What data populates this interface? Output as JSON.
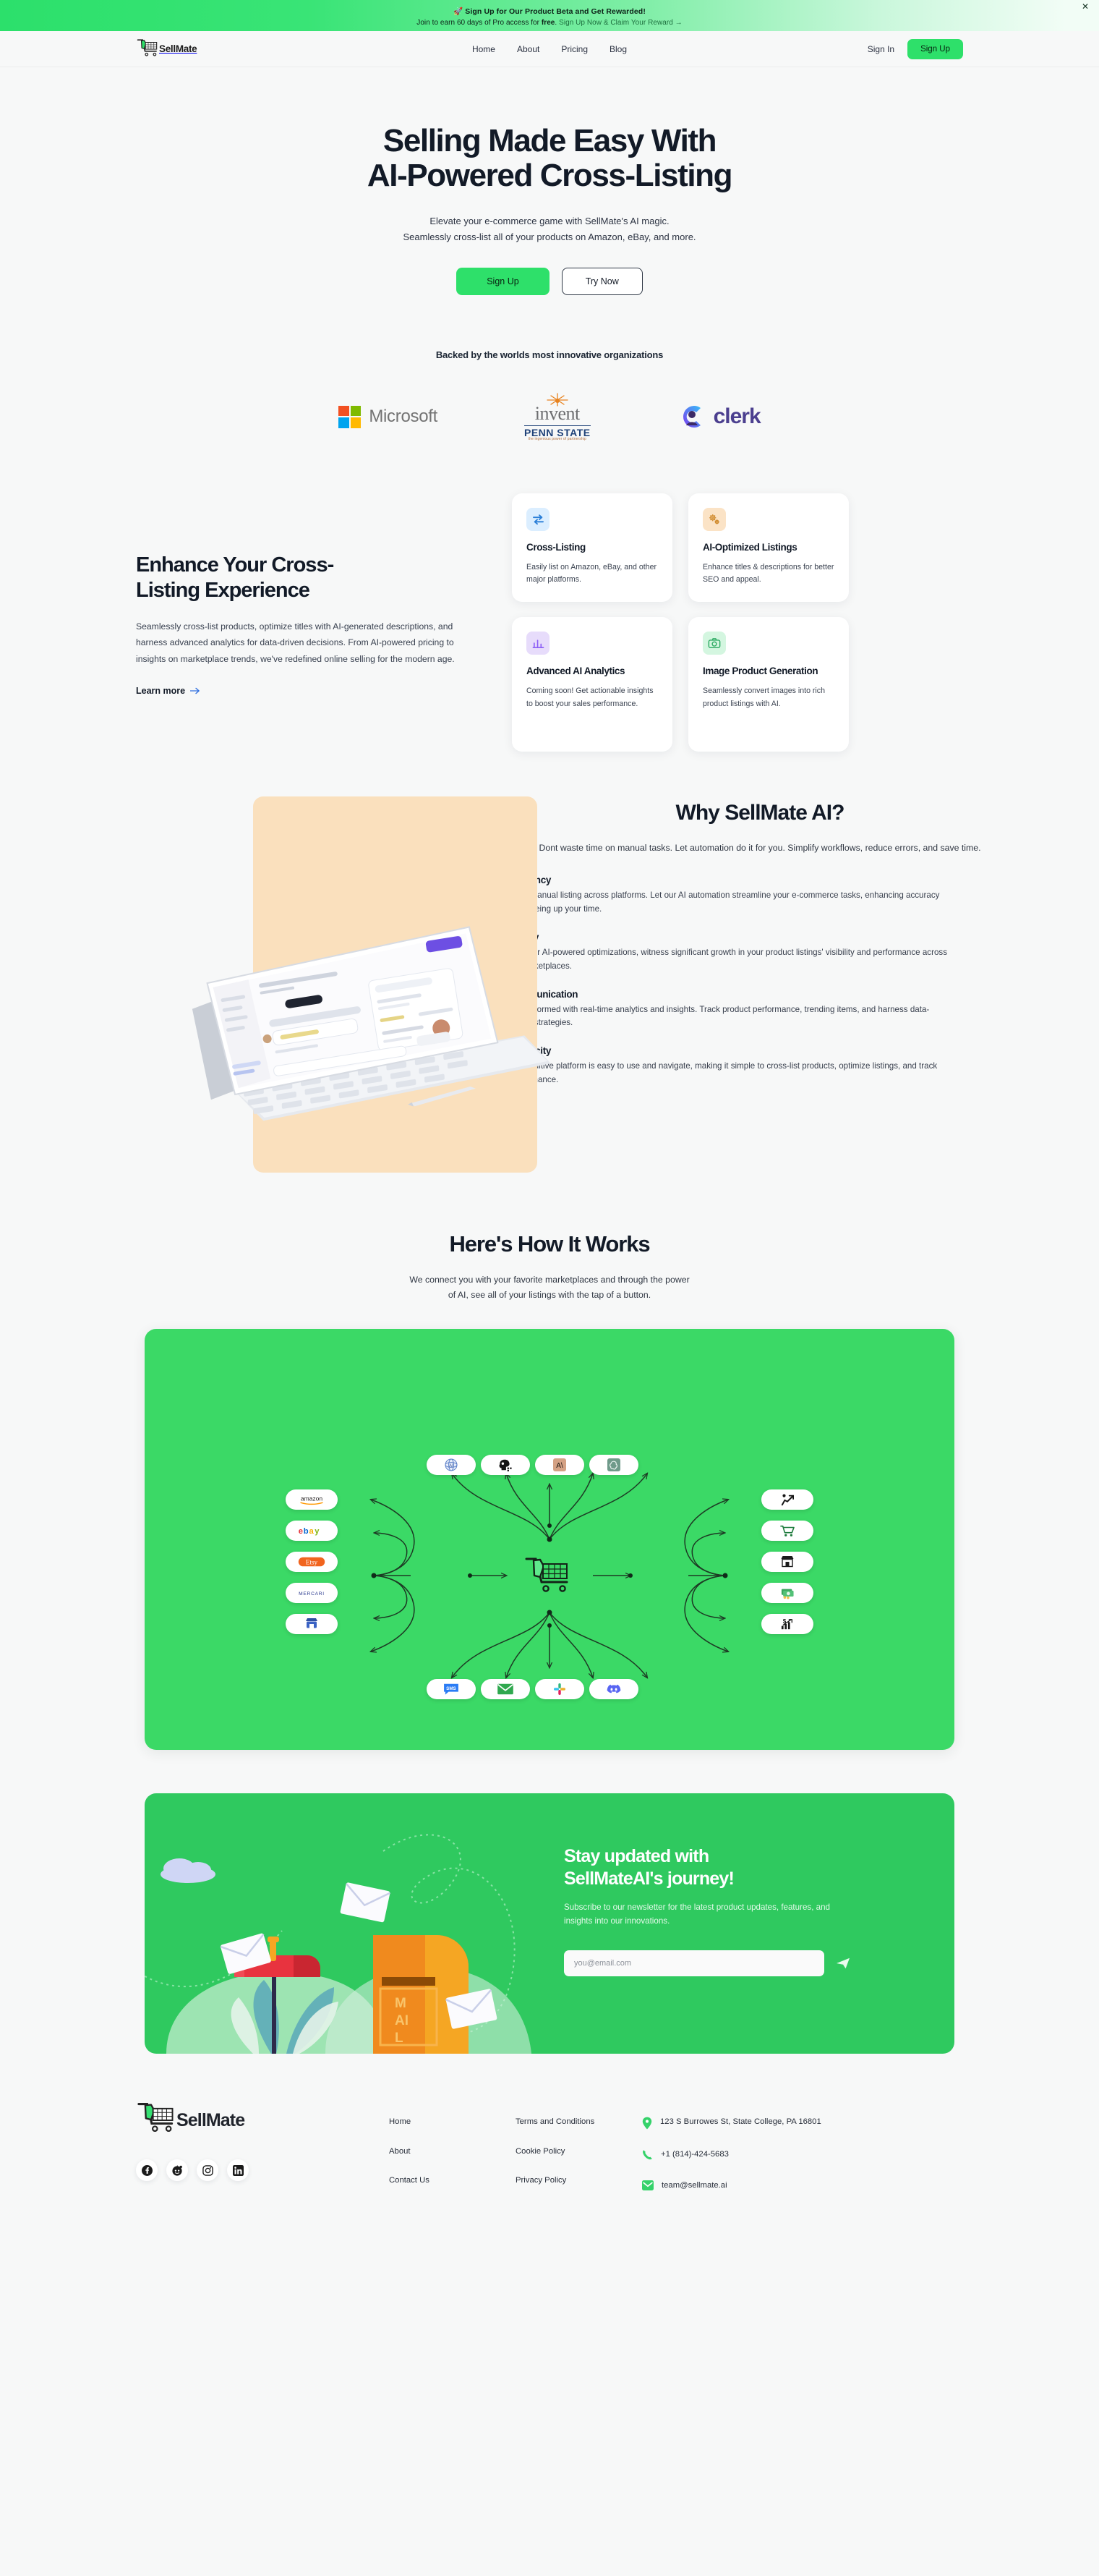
{
  "announcement": {
    "rocket_icon": "rocket-icon",
    "line1": "Sign Up for Our Product Beta and Get Rewarded!",
    "line2_prefix": "Join to earn 60 days of Pro access for ",
    "line2_bold": "free",
    "line2_mid": ". ",
    "line2_link": "Sign Up Now & Claim Your Reward →",
    "close_label": "✕"
  },
  "header": {
    "brand": "SellMate",
    "nav": [
      {
        "label": "Home"
      },
      {
        "label": "About"
      },
      {
        "label": "Pricing"
      },
      {
        "label": "Blog"
      }
    ],
    "sign_in": "Sign In",
    "sign_up": "Sign Up"
  },
  "hero": {
    "title_line1": "Selling Made Easy With",
    "title_line2": "AI-Powered Cross-Listing",
    "sub_line1": "Elevate your e-commerce game with SellMate's AI magic.",
    "sub_line2": "Seamlessly cross-list all of your products on Amazon, eBay, and more.",
    "cta_primary": "Sign Up",
    "cta_secondary": "Try Now"
  },
  "backers": {
    "heading": "Backed by the worlds most innovative organizations",
    "logos": [
      {
        "name": "Microsoft",
        "word": "Microsoft"
      },
      {
        "name": "Invent Penn State",
        "invent": "invent",
        "state": "PENN STATE",
        "tagline": "the ingenious power of partnership"
      },
      {
        "name": "Clerk",
        "word": "clerk"
      }
    ]
  },
  "enhance": {
    "title_line1": "Enhance Your Cross-",
    "title_line2": "Listing Experience",
    "body": "Seamlessly cross-list products, optimize titles with AI-generated descriptions, and harness advanced analytics for data-driven decisions. From AI-powered pricing to insights on marketplace trends, we've redefined online selling for the modern age.",
    "learn_more": "Learn more",
    "cards": [
      {
        "icon": "swap-arrows-icon",
        "icon_bg": "#dbeeff",
        "icon_color": "#2b7fd8",
        "title": "Cross-Listing",
        "body": "Easily list on Amazon, eBay, and other major platforms."
      },
      {
        "icon": "gears-icon",
        "icon_bg": "#fbe3c6",
        "icon_color": "#d08a2c",
        "title": "AI-Optimized Listings",
        "body": "Enhance titles & descriptions for better SEO and appeal."
      },
      {
        "icon": "bar-chart-icon",
        "icon_bg": "#e7dcfb",
        "icon_color": "#8b5cf6",
        "title": "Advanced AI Analytics",
        "body": "Coming soon! Get actionable insights to boost your sales performance."
      },
      {
        "icon": "camera-icon",
        "icon_bg": "#d4f6e0",
        "icon_color": "#2eab63",
        "title": "Image Product Generation",
        "body": "Seamlessly convert images into rich product listings with AI."
      }
    ]
  },
  "why": {
    "title": "Why SellMate AI?",
    "subtitle": "Dont waste time on manual tasks. Let automation do it for you. Simplify workflows, reduce errors, and save time.",
    "items": [
      {
        "title": "Efficiency",
        "body": "Ditch manual listing across platforms. Let our AI automation streamline your e-commerce tasks, enhancing accuracy and freeing up your time."
      },
      {
        "title": "Quality",
        "body": "With our AI-powered optimizations, witness significant growth in your product listings' visibility and performance across all marketplaces."
      },
      {
        "title": "Communication",
        "body": "Stay informed with real-time analytics and insights. Track product performance, trending items, and harness data-driven strategies."
      },
      {
        "title": "Simplicity",
        "body": "Our intuitive platform is easy to use and navigate, making it simple to cross-list products, optimize listings, and track performance."
      }
    ]
  },
  "how": {
    "title": "Here's How It Works",
    "subtitle_line1": "We connect you with your favorite marketplaces and through the power",
    "subtitle_line2": "of AI, see all of your listings with the tap of a button.",
    "panel_color": "#3bd966",
    "diagram": {
      "center": "sellmate-cart-logo",
      "top_row": [
        {
          "name": "ai21-icon",
          "label": "AI21"
        },
        {
          "name": "ai-brain-icon",
          "label": "AI Brain"
        },
        {
          "name": "anthropic-icon",
          "label": "Anthropic"
        },
        {
          "name": "openai-icon",
          "label": "OpenAI"
        }
      ],
      "left_column": [
        {
          "name": "amazon-logo",
          "label": "amazon"
        },
        {
          "name": "ebay-logo",
          "label": "ebay"
        },
        {
          "name": "etsy-logo",
          "label": "Etsy"
        },
        {
          "name": "mercari-logo",
          "label": "MERCARI"
        },
        {
          "name": "storefront-icon",
          "label": "Shopify"
        }
      ],
      "right_column": [
        {
          "name": "growth-icon",
          "label": "Growth"
        },
        {
          "name": "cart-icon",
          "label": "Cart"
        },
        {
          "name": "store-icon",
          "label": "Store"
        },
        {
          "name": "money-icon",
          "label": "Money"
        },
        {
          "name": "revenue-chart-icon",
          "label": "Revenue"
        }
      ],
      "bottom_row": [
        {
          "name": "sms-icon",
          "label": "SMS"
        },
        {
          "name": "email-icon",
          "label": "Email"
        },
        {
          "name": "slack-icon",
          "label": "Slack"
        },
        {
          "name": "discord-icon",
          "label": "Discord"
        }
      ]
    }
  },
  "newsletter": {
    "title_line1": "Stay updated with",
    "title_line2": "SellMateAI's journey!",
    "body": "Subscribe to our newsletter for the latest product updates, features, and insights into our innovations.",
    "input_placeholder": "you@email.com",
    "input_value": "",
    "send_icon": "send-icon"
  },
  "footer": {
    "brand": "SellMate",
    "socials": [
      {
        "name": "facebook-icon",
        "label": "Facebook"
      },
      {
        "name": "reddit-icon",
        "label": "Reddit"
      },
      {
        "name": "instagram-icon",
        "label": "Instagram"
      },
      {
        "name": "linkedin-icon",
        "label": "LinkedIn"
      }
    ],
    "links_col1": [
      {
        "label": "Home"
      },
      {
        "label": "About"
      },
      {
        "label": "Contact Us"
      }
    ],
    "links_col2": [
      {
        "label": "Terms and Conditions"
      },
      {
        "label": "Cookie Policy"
      },
      {
        "label": "Privacy Policy"
      }
    ],
    "contact": {
      "address": "123 S Burrowes St, State College, PA 16801",
      "phone": "+1 (814)-424-5683",
      "email": "team@sellmate.ai"
    }
  },
  "colors": {
    "accent_green": "#2ee06a",
    "panel_green": "#3bd966",
    "newsletter_green": "#2fc95f",
    "ink": "#121a27",
    "page_bg": "#f7f8f8"
  }
}
